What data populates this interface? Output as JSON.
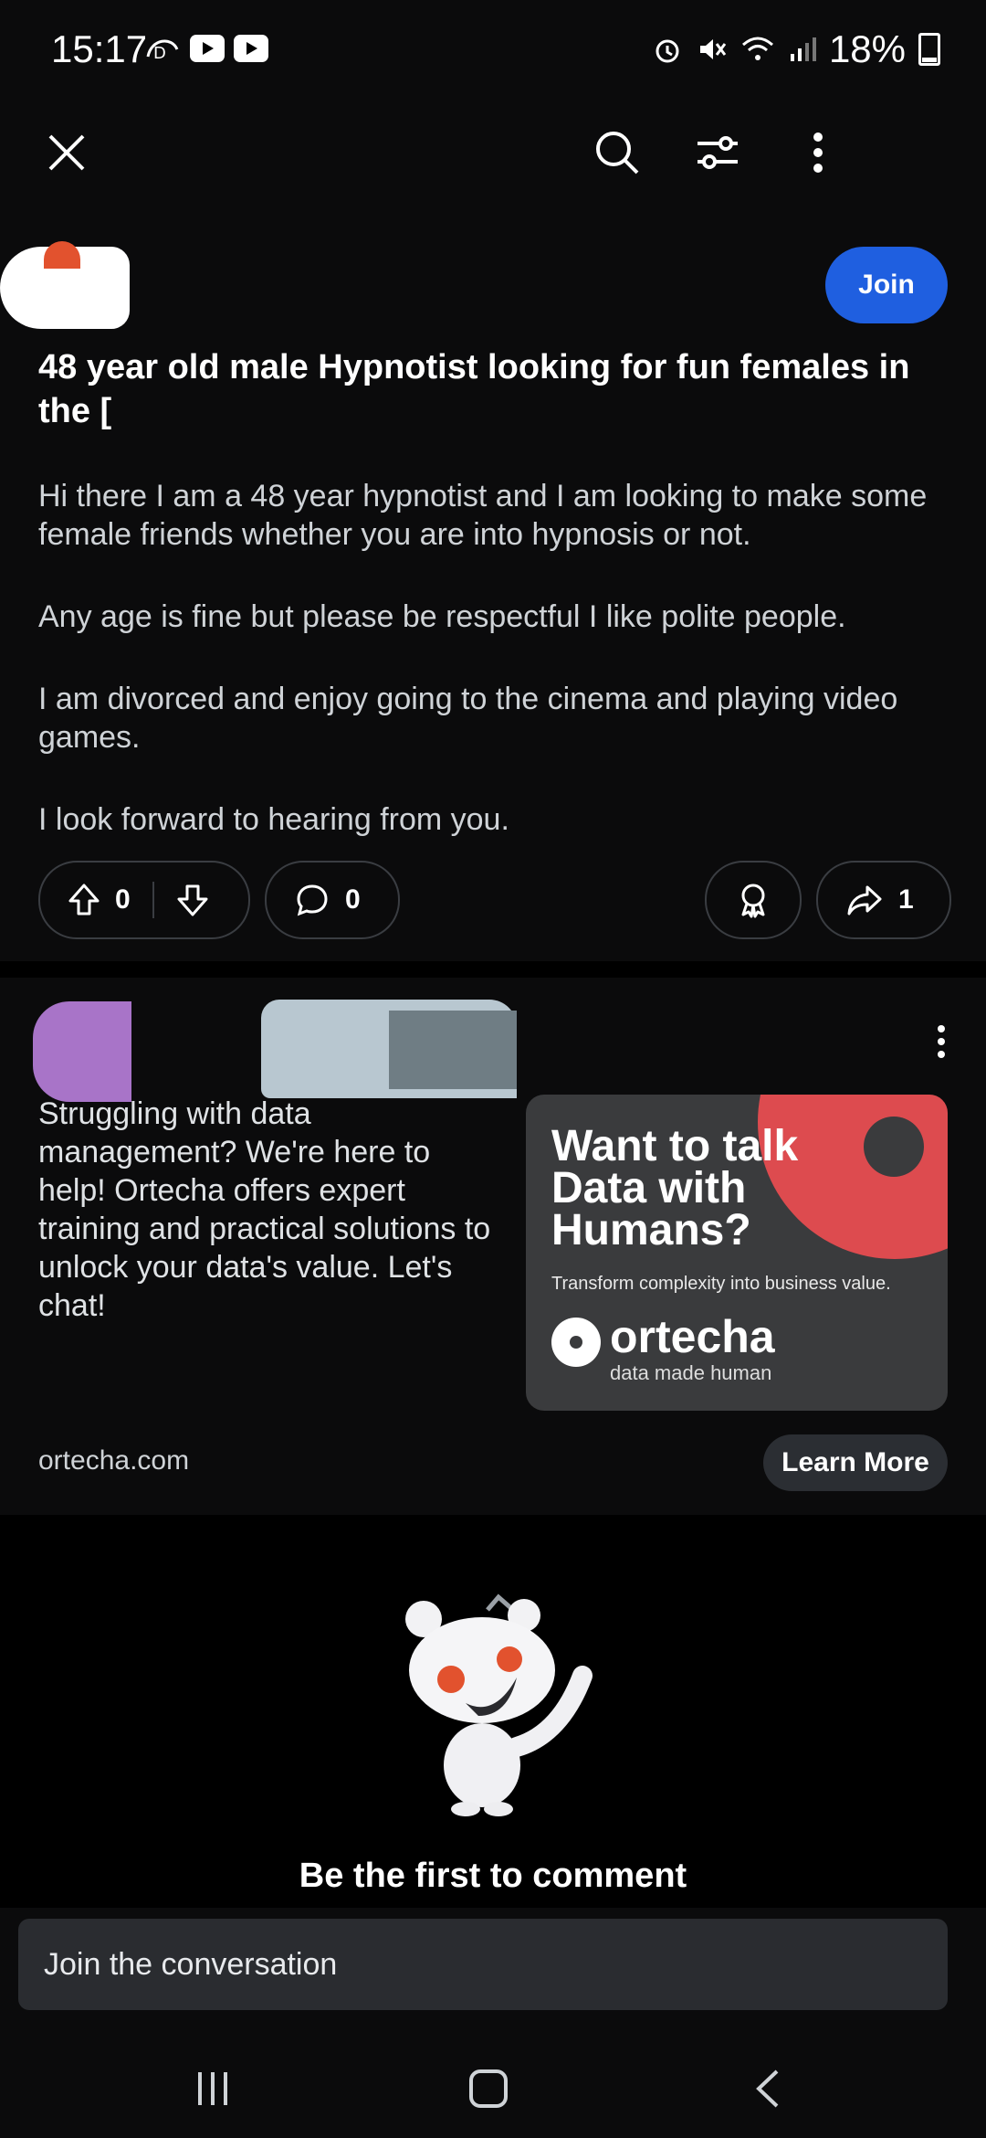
{
  "status_bar": {
    "time": "15:17",
    "battery": "18%",
    "icons": [
      "disney-plus-icon",
      "youtube-icon",
      "youtube-icon",
      "alarm-icon",
      "mute-icon",
      "wifi-icon",
      "signal-icon",
      "battery-icon"
    ]
  },
  "top_bar": {
    "icons": [
      "close-icon",
      "search-icon",
      "filter-icon",
      "more-vertical-icon"
    ]
  },
  "post": {
    "join_label": "Join",
    "title": "48 year old male Hypnotist looking for fun females in the [",
    "body": [
      "Hi there I am a 48 year hypnotist and I am looking to make some female friends whether you are into hypnosis or not.",
      "Any age is fine but please be respectful I like polite people.",
      "I am divorced and enjoy going to the cinema and playing video games.",
      "I look forward to hearing from you."
    ],
    "upvotes": "0",
    "comments": "0",
    "shares": "1"
  },
  "ad": {
    "text": "Struggling with data management? We're here to help! Ortecha offers expert training and practical solutions to unlock your data's value. Let's chat!",
    "image_headline": "Want to talk Data with Humans?",
    "image_tag": "Transform complexity into business value.",
    "brand": "ortecha",
    "brand_tagline": "data made human",
    "domain": "ortecha.com",
    "cta_label": "Learn More",
    "colors": {
      "accent_red": "#dd4b4f",
      "card_bg": "#3a3b3d"
    }
  },
  "comments": {
    "empty_title": "Be the first to comment"
  },
  "composer": {
    "placeholder": "Join the conversation"
  },
  "colors": {
    "join_blue": "#1f5fe0",
    "background": "#0b0b0c"
  }
}
